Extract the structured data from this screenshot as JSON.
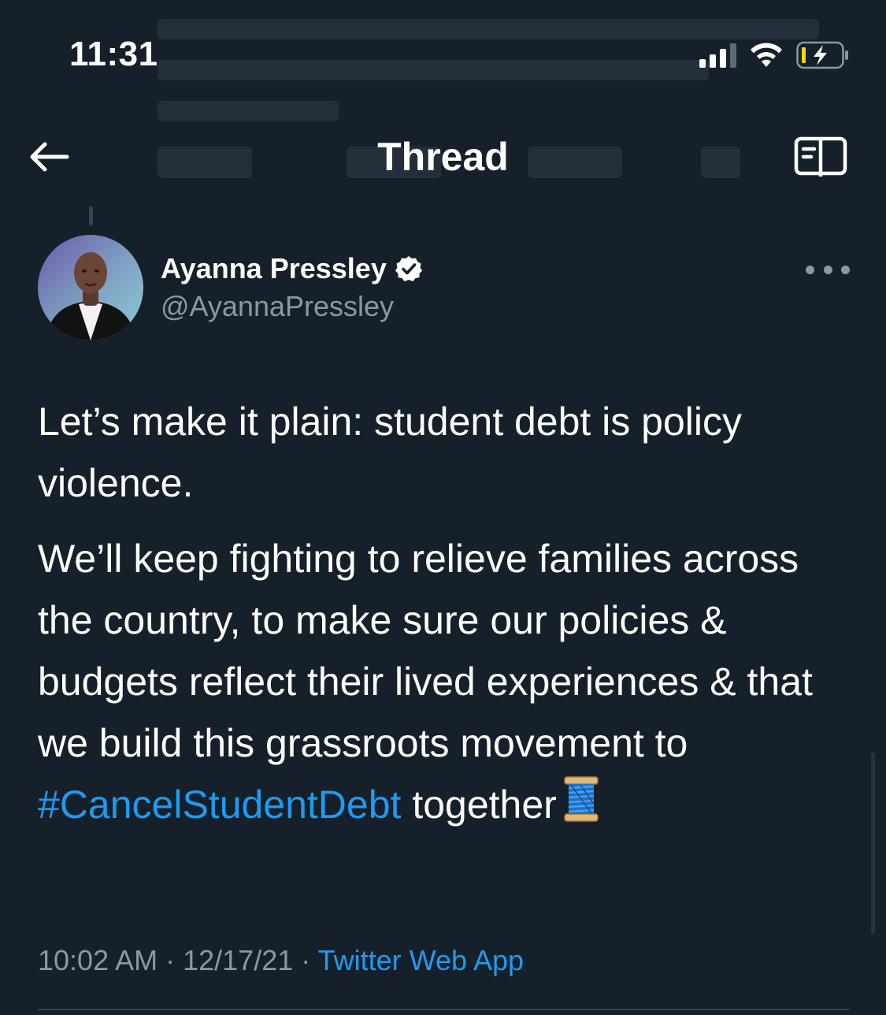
{
  "status_bar": {
    "time": "11:31",
    "signal_icon": "cellular-signal-icon",
    "wifi_icon": "wifi-icon",
    "battery_icon": "battery-charging-icon"
  },
  "header": {
    "title": "Thread",
    "back_icon": "back-arrow-icon",
    "reader_icon": "reader-mode-icon"
  },
  "tweet": {
    "author_name": "Ayanna Pressley",
    "verified_icon": "verified-badge-icon",
    "handle": "@AyannaPressley",
    "more_icon": "more-options-icon",
    "paragraph_1": "Let’s make it plain: student debt is policy violence.",
    "paragraph_2_text": "We’ll keep fighting to relieve families across the country, to make sure our policies & budgets reflect their lived experiences & that we build this grassroots movement to",
    "hashtag": "#CancelStudentDebt",
    "paragraph_2_end": " together",
    "emoji_icon": "spool-of-thread-emoji",
    "time": "10:02 AM",
    "date": "12/17/21",
    "source": "Twitter Web App",
    "separator": " · "
  },
  "colors": {
    "background": "#15202b",
    "text": "#ffffff",
    "secondary_text": "#8899a6",
    "accent": "#1d9bf0",
    "divider": "#38444d"
  }
}
